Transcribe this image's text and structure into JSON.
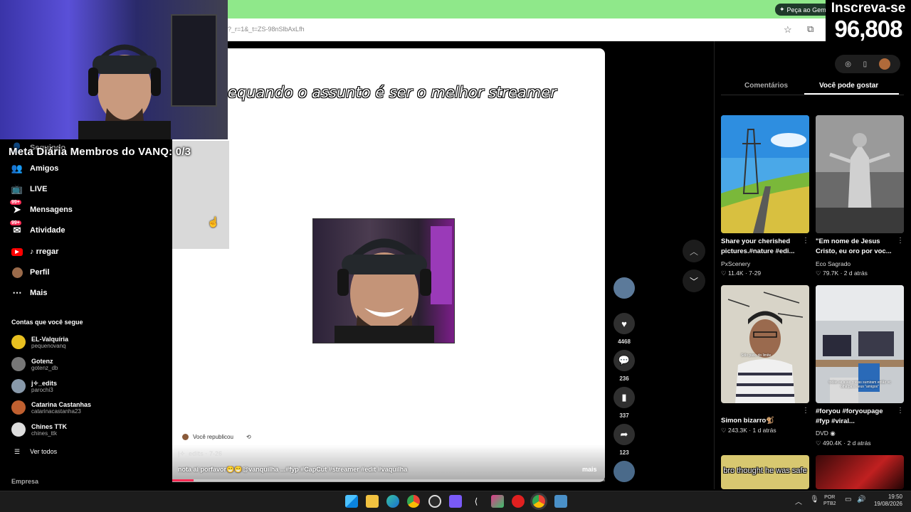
{
  "browser": {
    "url": "?_r=1&_t=ZS-98nSlbAxLfh",
    "gemini_button": "Peça ao Gem"
  },
  "stream_overlay": {
    "subscribe_label": "Inscreva-se",
    "subscriber_count": "96,808",
    "goal_text": "Meta Diária Membros do VANQ: 0/3"
  },
  "sidebar": {
    "items": [
      {
        "label": "Seguindo",
        "icon": "person-icon"
      },
      {
        "label": "Amigos",
        "icon": "friends-icon"
      },
      {
        "label": "LIVE",
        "icon": "live-icon"
      },
      {
        "label": "Mensagens",
        "icon": "messages-icon",
        "badge": "99+"
      },
      {
        "label": "Atividade",
        "icon": "activity-icon",
        "badge": "99+"
      },
      {
        "label": "rregar",
        "icon": "youtube-icon"
      },
      {
        "label": "Perfil",
        "icon": "avatar-icon"
      },
      {
        "label": "Mais",
        "icon": "more-icon"
      }
    ],
    "following_title": "Contas que você segue",
    "accounts": [
      {
        "name": "EL-Valquíria",
        "handle": "pequenovanq",
        "color": "#e8c020"
      },
      {
        "name": "Gotenz",
        "handle": "gotenz_db",
        "color": "#777777"
      },
      {
        "name": "j✧_edits",
        "handle": "parochi3",
        "color": "#8899aa"
      },
      {
        "name": "Catarina Castanhas",
        "handle": "catarinacastanha23",
        "color": "#c06030"
      },
      {
        "name": "Chines TTK",
        "handle": "chines_ttk",
        "color": "#dddddd"
      }
    ],
    "see_all": "Ver todos",
    "company": "Empresa"
  },
  "video": {
    "caption": "equando o assunto é ser o melhor streamer",
    "reposted_label": "Você republicou",
    "repost_author": "j✧_edits · 7-26",
    "description": "nota aí porfavor😁😁@vanquilha ...#fyp #CapCut #streamer #edit #vaquilha",
    "more_label": "mais",
    "progress": 0.05
  },
  "actions": {
    "likes": "4468",
    "comments": "236",
    "saves": "337",
    "shares": "123"
  },
  "right_panel": {
    "tabs": [
      "Comentários",
      "Você pode gostar"
    ],
    "active_tab": "Você pode gostar",
    "cards": [
      {
        "title": "Share your cherished pictures.#nature #edi...",
        "author": "PxScenery",
        "likes": "11.4K",
        "date": "7-29"
      },
      {
        "title": "\"Em nome de Jesus Cristo, eu oro por voc...",
        "author": "Eco Sagrado",
        "likes": "79.7K",
        "date": "2 d atrás"
      },
      {
        "title": "Simon bizarro🐒",
        "author": "",
        "likes": "243.3K",
        "date": "1 d atrás"
      },
      {
        "title": "#foryou #foryoupage #fyp #viral...",
        "author": "DVD",
        "likes": "490.4K",
        "date": "2 d atrás"
      }
    ],
    "card5_overlay": "bro thought he was safe",
    "card3_overlay": "Sólo paso do limite",
    "card4_overlay": "todas as suas coisas sumiram então vc olha para seus \"amigos\""
  },
  "taskbar": {
    "lang": "POR",
    "layout": "PTB2",
    "time": "19:50",
    "date": "19/08/2026"
  }
}
